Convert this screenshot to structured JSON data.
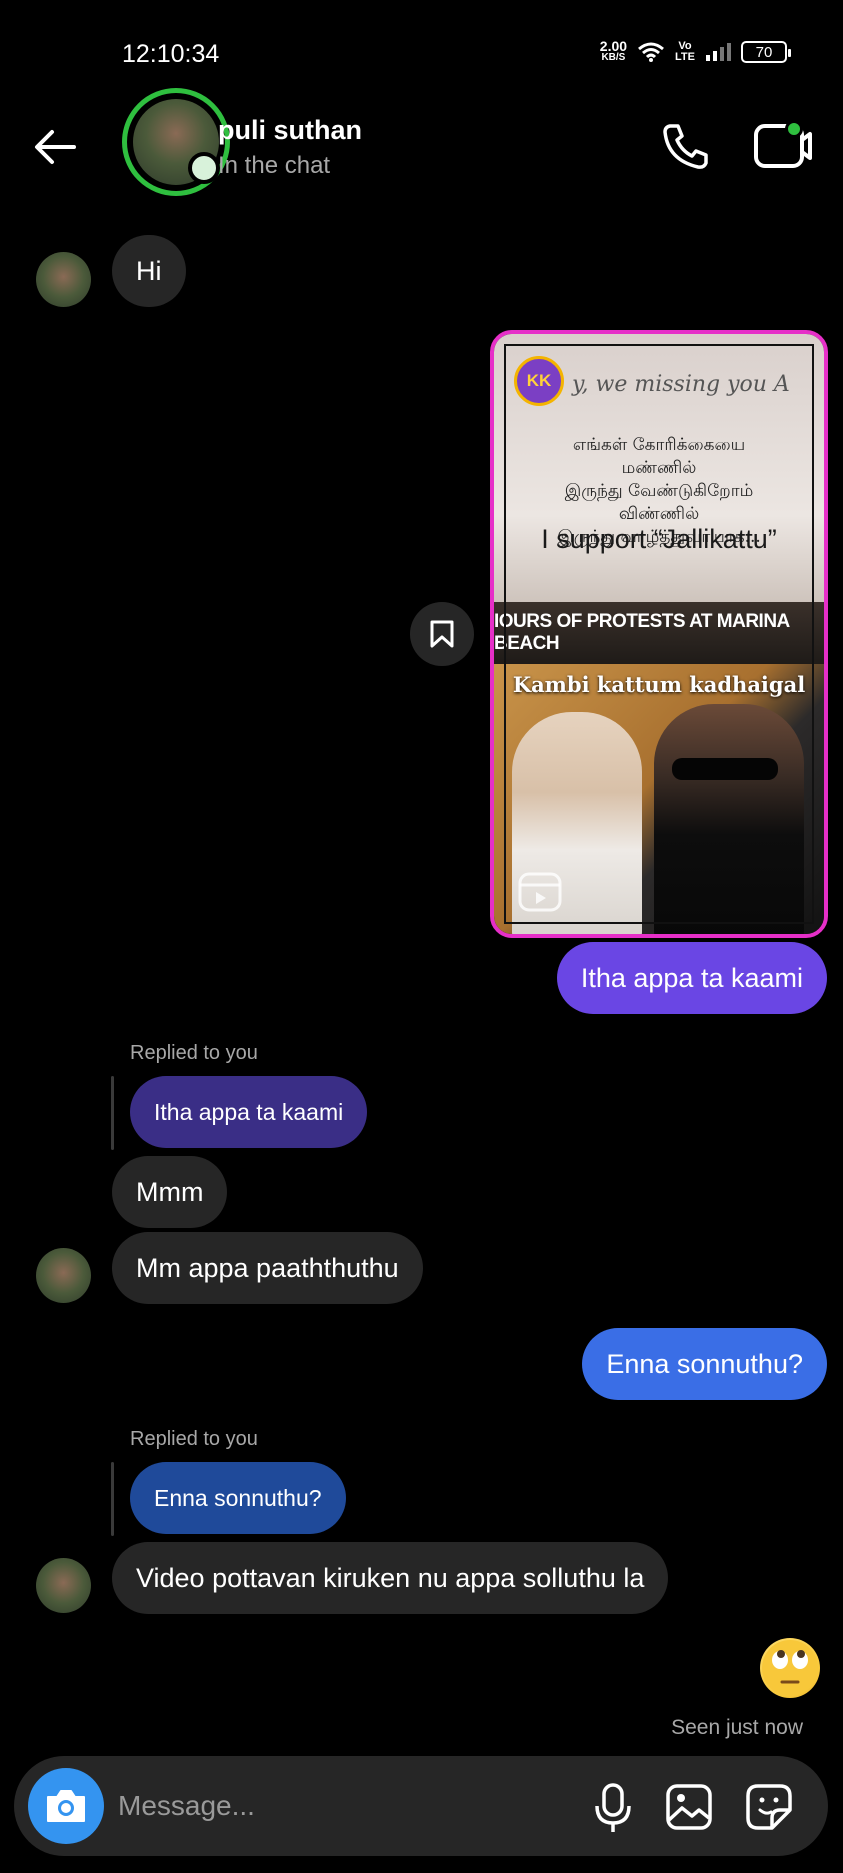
{
  "status_bar": {
    "time": "12:10:34",
    "net_speed": "2.00",
    "net_unit": "KB/S",
    "volte_top": "Vo",
    "volte_bottom": "LTE",
    "battery": "70"
  },
  "header": {
    "contact_name": "puli suthan",
    "contact_status": "In the chat"
  },
  "messages": [
    {
      "side": "in",
      "text": "Hi"
    },
    {
      "side": "out",
      "kind": "shared-reel",
      "reel": {
        "logo": "KK",
        "top_caption": "y, we missing you A",
        "tamil_lines": [
          "எங்கள் கோரிக்கையை",
          "மண்ணில்",
          "இருந்து வேண்டுகிறோம்",
          "விண்ணில்",
          "இருந்து வாழ்த்துவாயாக..."
        ],
        "support_text": "I support “Jallikattu”",
        "banner_text": "IOURS OF PROTESTS AT MARINA BEACH",
        "bottom_title": "Kambi kattum kadhaigal"
      }
    },
    {
      "side": "out",
      "text": "Itha appa ta kaami"
    },
    {
      "side": "in",
      "reply_label": "Replied to you",
      "quoted": "Itha appa ta kaami"
    },
    {
      "side": "in",
      "text": "Mmm"
    },
    {
      "side": "in",
      "text": "Mm appa paaththuthu"
    },
    {
      "side": "out",
      "text": "Enna sonnuthu?"
    },
    {
      "side": "in",
      "reply_label": "Replied to you",
      "quoted": "Enna sonnuthu?"
    },
    {
      "side": "in",
      "text": "Video pottavan kiruken nu appa solluthu la"
    },
    {
      "side": "out",
      "kind": "emoji",
      "emoji_name": "face-with-rolling-eyes"
    }
  ],
  "seen_text": "Seen just now",
  "composer": {
    "placeholder": "Message..."
  },
  "colors": {
    "background": "#000000",
    "incoming_bubble": "#262626",
    "outgoing_purple": "#6a46e4",
    "outgoing_blue": "#3a6ee6",
    "online_green": "#2fbf3f",
    "camera_blue": "#3494f0",
    "reel_border": "#e62fc8"
  },
  "icons": [
    "back-arrow-icon",
    "phone-icon",
    "video-call-icon",
    "bookmark-icon",
    "reel-icon",
    "camera-icon",
    "microphone-icon",
    "gallery-icon",
    "sticker-icon",
    "wifi-icon",
    "signal-icon"
  ]
}
